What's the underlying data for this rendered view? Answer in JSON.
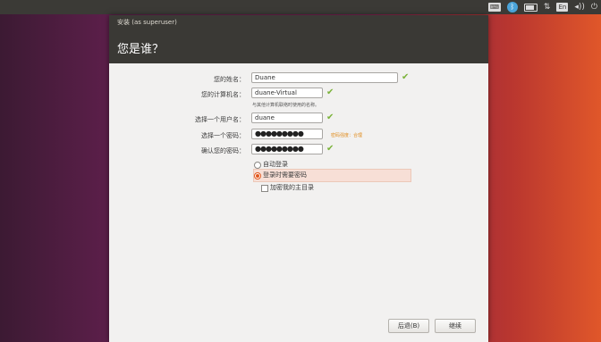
{
  "topbar": {
    "keyboard": "En",
    "volume": "◂))",
    "power": "⏻"
  },
  "window": {
    "title": "安装 (as superuser)",
    "header": "您是谁？"
  },
  "form": {
    "name_label": "您的姓名：",
    "name_value": "Duane",
    "computer_label": "您的计算机名：",
    "computer_value": "duane-Virtual",
    "computer_hint": "与其他计算机联络时使用的名称。",
    "username_label": "选择一个用户名：",
    "username_value": "duane",
    "password_label": "选择一个密码：",
    "password_value": "●●●●●●●●●",
    "password_strength": "密码强度：合理",
    "confirm_label": "确认您的密码：",
    "confirm_value": "●●●●●●●●●"
  },
  "options": {
    "auto_login": "自动登录",
    "require_password": "登录时需要密码",
    "encrypt_home": "加密我的主目录"
  },
  "buttons": {
    "back": "后退(B)",
    "continue": "继续"
  },
  "colors": {
    "accent": "#e1571c",
    "check": "#7bb33a",
    "titlebar": "#3a3935"
  }
}
